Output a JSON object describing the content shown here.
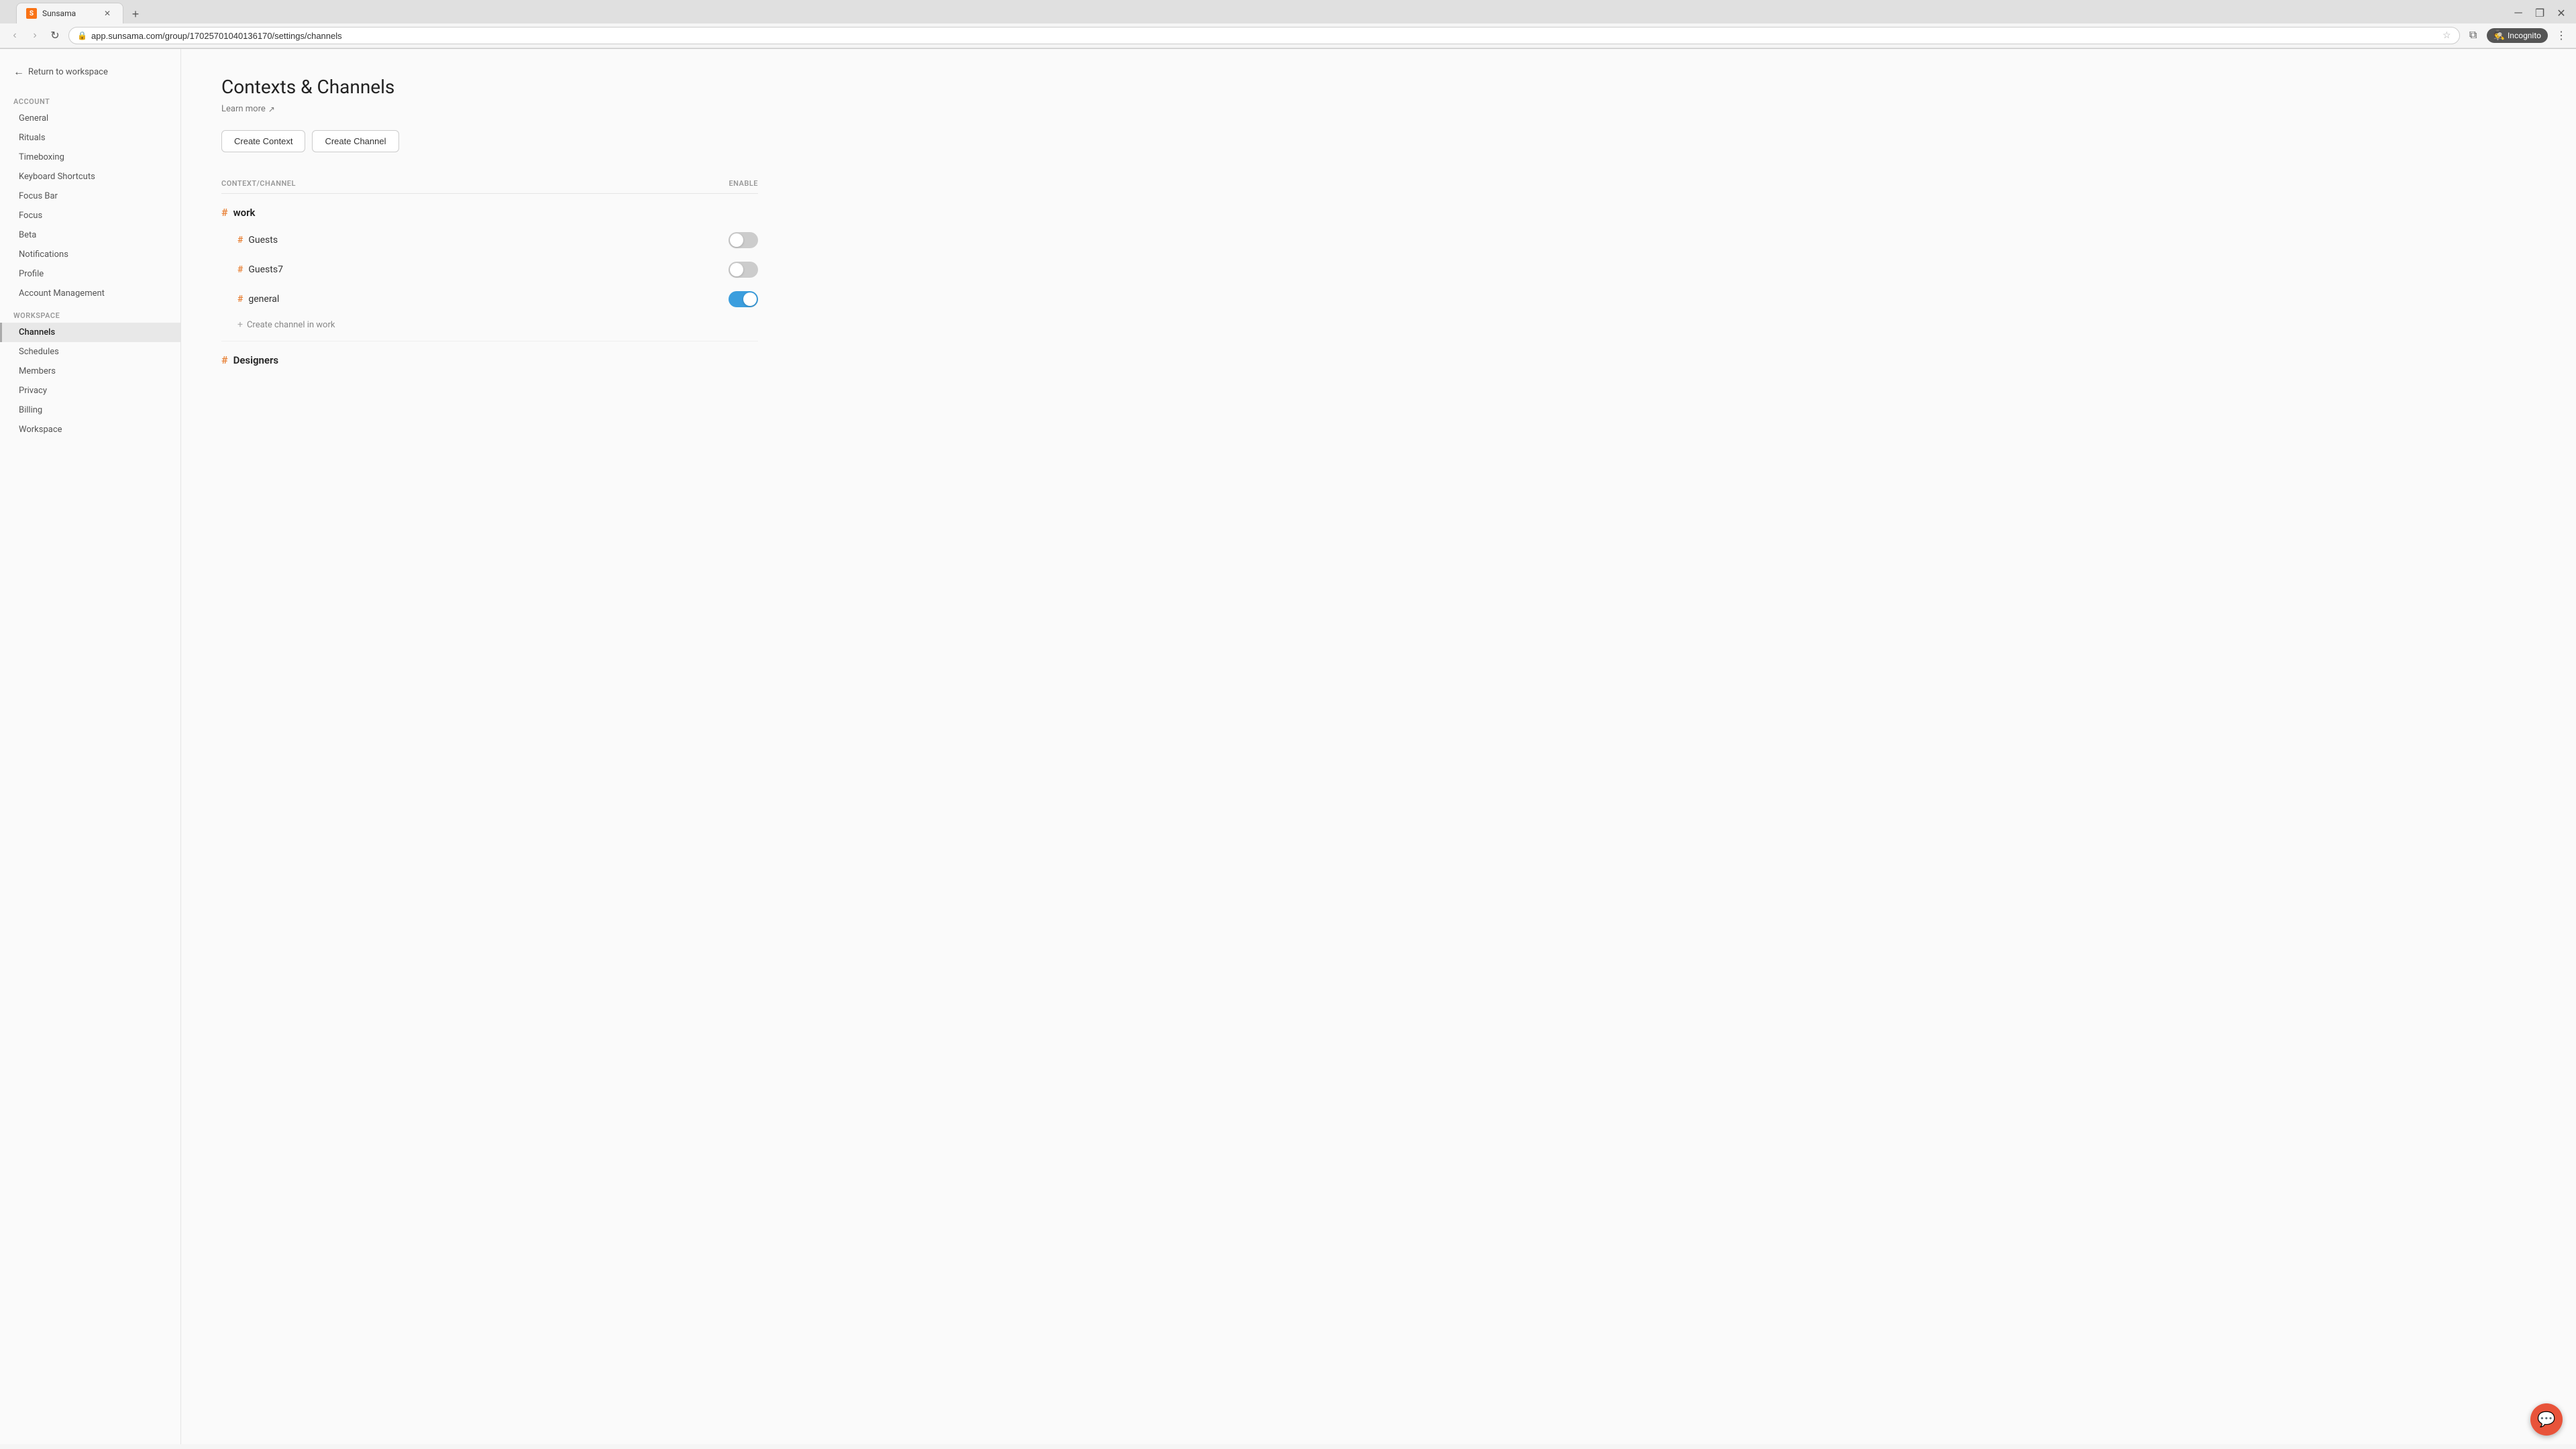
{
  "browser": {
    "tab_favicon": "S",
    "tab_title": "Sunsama",
    "address": "app.sunsama.com/group/17025701040136170/settings/channels",
    "incognito_label": "Incognito",
    "back_tooltip": "Back",
    "forward_tooltip": "Forward",
    "refresh_tooltip": "Refresh"
  },
  "sidebar": {
    "back_label": "Return to workspace",
    "account_section": "Account",
    "account_items": [
      {
        "id": "general",
        "label": "General",
        "active": false
      },
      {
        "id": "rituals",
        "label": "Rituals",
        "active": false
      },
      {
        "id": "timeboxing",
        "label": "Timeboxing",
        "active": false
      },
      {
        "id": "keyboard-shortcuts",
        "label": "Keyboard Shortcuts",
        "active": false
      },
      {
        "id": "focus-bar",
        "label": "Focus Bar",
        "active": false
      },
      {
        "id": "focus",
        "label": "Focus",
        "active": false
      },
      {
        "id": "beta",
        "label": "Beta",
        "active": false
      },
      {
        "id": "notifications",
        "label": "Notifications",
        "active": false
      },
      {
        "id": "profile",
        "label": "Profile",
        "active": false
      },
      {
        "id": "account-management",
        "label": "Account Management",
        "active": false
      }
    ],
    "workspace_section": "Workspace",
    "workspace_items": [
      {
        "id": "channels",
        "label": "Channels",
        "active": true
      },
      {
        "id": "schedules",
        "label": "Schedules",
        "active": false
      },
      {
        "id": "members",
        "label": "Members",
        "active": false
      },
      {
        "id": "privacy",
        "label": "Privacy",
        "active": false
      },
      {
        "id": "billing",
        "label": "Billing",
        "active": false
      },
      {
        "id": "workspace",
        "label": "Workspace",
        "active": false
      }
    ]
  },
  "main": {
    "title": "Contexts & Channels",
    "learn_more_label": "Learn more",
    "create_context_label": "Create Context",
    "create_channel_label": "Create Channel",
    "table_header_context": "CONTEXT/CHANNEL",
    "table_header_enable": "ENABLE",
    "contexts": [
      {
        "id": "work",
        "name": "work",
        "channels": [
          {
            "id": "guests",
            "name": "Guests",
            "enabled": false
          },
          {
            "id": "guests7",
            "name": "Guests7",
            "enabled": false
          },
          {
            "id": "general",
            "name": "general",
            "enabled": true
          }
        ],
        "create_channel_label": "Create channel in work"
      },
      {
        "id": "designers",
        "name": "Designers",
        "channels": [],
        "create_channel_label": ""
      }
    ]
  },
  "chat_bubble_icon": "💬"
}
